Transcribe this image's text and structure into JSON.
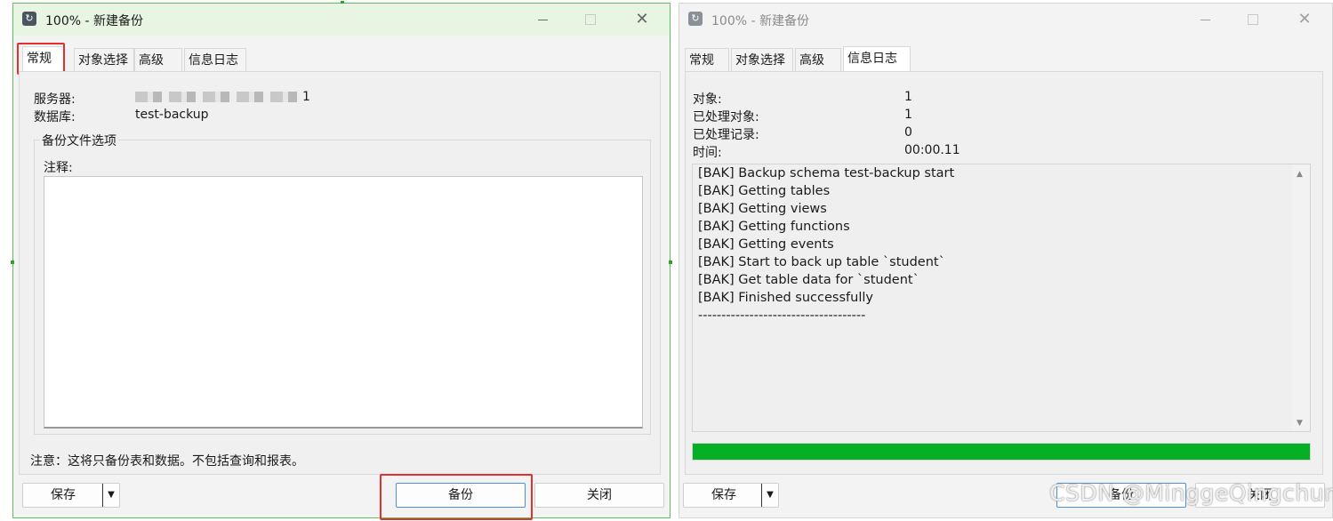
{
  "left_window": {
    "title": "100% - 新建备份",
    "tabs": [
      "常规",
      "对象选择",
      "高级",
      "信息日志"
    ],
    "active_tab": "常规",
    "server_label": "服务器:",
    "server_value_tail": "1",
    "database_label": "数据库:",
    "database_value": "test-backup",
    "group_title": "备份文件选项",
    "comment_label": "注释:",
    "comment_value": "",
    "note": "注意：这将只备份表和数据。不包括查询和报表。",
    "save_label": "保存",
    "backup_label": "备份",
    "close_label": "关闭"
  },
  "right_window": {
    "title": "100% - 新建备份",
    "tabs": [
      "常规",
      "对象选择",
      "高级",
      "信息日志"
    ],
    "active_tab": "信息日志",
    "stats": [
      {
        "label": "对象:",
        "value": "1"
      },
      {
        "label": "已处理对象:",
        "value": "1"
      },
      {
        "label": "已处理记录:",
        "value": "0"
      },
      {
        "label": "时间:",
        "value": "00:00.11"
      }
    ],
    "log_lines": [
      "[BAK] Backup schema test-backup start",
      "[BAK] Getting tables",
      "[BAK] Getting views",
      "[BAK] Getting functions",
      "[BAK] Getting events",
      "[BAK] Start to back up table `student`",
      "[BAK] Get table data for `student`",
      "[BAK] Finished successfully",
      "------------------------------------"
    ],
    "progress": 1.0,
    "progress_color": "#06b025",
    "save_label": "保存",
    "backup_label": "备份",
    "close_label": "关闭"
  },
  "watermark": "CSDN @MinggeQingchun",
  "highlight_color": "#e53030"
}
